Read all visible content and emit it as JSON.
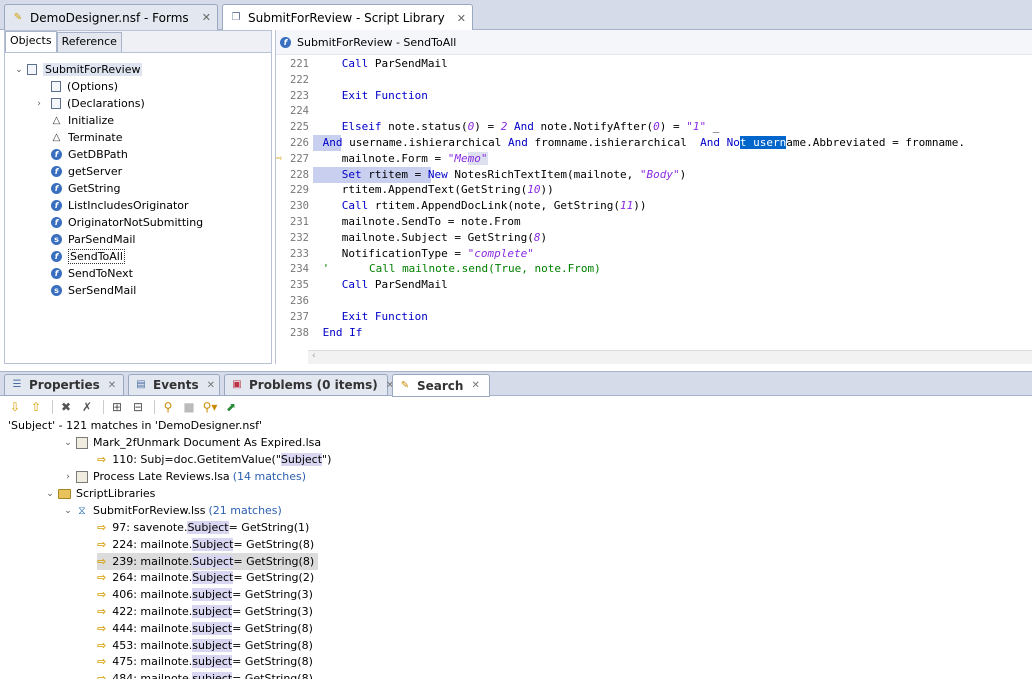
{
  "tabs": {
    "forms": {
      "label": "DemoDesigner.nsf - Forms",
      "close": "✕"
    },
    "library": {
      "label": "SubmitForReview - Script Library",
      "close": "✕"
    }
  },
  "left_pane": {
    "tabs": [
      "Objects",
      "Reference"
    ],
    "root": "SubmitForReview",
    "items": [
      "(Options)",
      "(Declarations)",
      "Initialize",
      "Terminate",
      "GetDBPath",
      "getServer",
      "GetString",
      "ListIncludesOriginator",
      "OriginatorNotSubmitting",
      "ParSendMail",
      "SendToAll",
      "SendToNext",
      "SerSendMail"
    ]
  },
  "editor": {
    "title": "SubmitForReview - SendToAll",
    "lines": [
      {
        "n": "221",
        "t": "Call ParSendMail"
      },
      {
        "n": "222",
        "t": ""
      },
      {
        "n": "223",
        "t": "Exit Function"
      },
      {
        "n": "224",
        "t": ""
      },
      {
        "n": "225",
        "t": "Elseif note.status(0) = 2 And note.NotifyAfter(0) = \"1\" _"
      },
      {
        "n": "226",
        "t": "And username.ishierarchical And fromname.ishierarchical  And Not username.Abbreviated = fromname."
      },
      {
        "n": "227",
        "t": "mailnote.Form = \"Memo\""
      },
      {
        "n": "228",
        "t": "Set rtitem = New NotesRichTextItem(mailnote, \"Body\")"
      },
      {
        "n": "229",
        "t": "rtitem.AppendText(GetString(10))"
      },
      {
        "n": "230",
        "t": "Call rtitem.AppendDocLink(note, GetString(11))"
      },
      {
        "n": "231",
        "t": "mailnote.SendTo = note.From"
      },
      {
        "n": "232",
        "t": "mailnote.Subject = GetString(8)"
      },
      {
        "n": "233",
        "t": "NotificationType = \"complete\""
      },
      {
        "n": "234",
        "t": "'      Call mailnote.send(True, note.From)"
      },
      {
        "n": "235",
        "t": "Call ParSendMail"
      },
      {
        "n": "236",
        "t": ""
      },
      {
        "n": "237",
        "t": "Exit Function"
      },
      {
        "n": "238",
        "t": "End If"
      }
    ]
  },
  "bottom_tabs": {
    "properties": "Properties",
    "events": "Events",
    "problems": "Problems (0 items)",
    "search": "Search",
    "close": "✕"
  },
  "search": {
    "summary": "'Subject' - 121 matches in 'DemoDesigner.nsf'",
    "file1": "Mark_2fUnmark Document As Expired.lsa",
    "file1_match": {
      "prefix": "110: Subj=doc.GetitemValue(\"",
      "hit": "Subject",
      "suffix": "\")"
    },
    "file2": "Process Late Reviews.lsa",
    "file2_count": "(14 matches)",
    "folder": "ScriptLibraries",
    "lib": "SubmitForReview.lss",
    "lib_count": "(21 matches)",
    "matches": [
      {
        "prefix": "97: savenote.",
        "hit": "Subject",
        "suffix": " = GetString(1)"
      },
      {
        "prefix": "224: mailnote.",
        "hit": "Subject",
        "suffix": " = GetString(8)"
      },
      {
        "prefix": "239: mailnote.",
        "hit": "Subject",
        "suffix": " = GetString(8)"
      },
      {
        "prefix": "264: mailnote.",
        "hit": "Subject",
        "suffix": " = GetString(2)"
      },
      {
        "prefix": "406: mailnote.",
        "hit": "subject",
        "suffix": " = GetString(3)"
      },
      {
        "prefix": "422: mailnote.",
        "hit": "subject",
        "suffix": " = GetString(3)"
      },
      {
        "prefix": "444: mailnote.",
        "hit": "subject",
        "suffix": " = GetString(8)"
      },
      {
        "prefix": "453: mailnote.",
        "hit": "subject",
        "suffix": " = GetString(8)"
      },
      {
        "prefix": "475: mailnote.",
        "hit": "subject",
        "suffix": " = GetString(8)"
      },
      {
        "prefix": "484: mailnote.",
        "hit": "subject",
        "suffix": " = GetString(8)"
      }
    ]
  }
}
